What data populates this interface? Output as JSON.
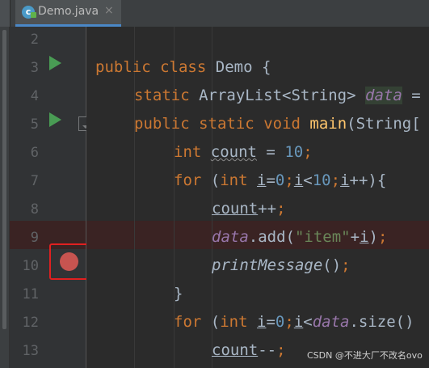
{
  "tab": {
    "title": "Demo.java",
    "close": "×",
    "icon_letter": "c"
  },
  "line_numbers": [
    "2",
    "3",
    "4",
    "5",
    "6",
    "7",
    "8",
    "9",
    "10",
    "11",
    "12",
    "13"
  ],
  "code": {
    "l3": {
      "kw1": "public",
      "kw2": "class",
      "name": "Demo",
      "rest": " {"
    },
    "l4": {
      "kw": "static",
      "type": "ArrayList<String>",
      "field": "data",
      "rest": " ="
    },
    "l5": {
      "kw1": "public",
      "kw2": "static",
      "kw3": "void",
      "method": "main",
      "rest": "(String["
    },
    "l6": {
      "kw": "int",
      "var": "count",
      "op": " = ",
      "num": "10",
      "semi": ";"
    },
    "l7": {
      "kw": "for",
      "p1": " (",
      "kw2": "int",
      "sp": " ",
      "i1": "i",
      "eq": "=",
      "n0": "0",
      "s1": ";",
      "i2": "i",
      "lt": "<",
      "n10": "10",
      "s2": ";",
      "i3": "i",
      "rest": "++){"
    },
    "l8": {
      "var": "count",
      "rest": "++",
      "semi": ";"
    },
    "l9": {
      "field": "data",
      "call": ".add(",
      "str": "\"item\"",
      "plus": "+",
      "i": "i",
      "end": ")",
      "semi": ";"
    },
    "l10": {
      "method": "printMessage",
      "rest": "()",
      "semi": ";"
    },
    "l11": {
      "brace": "}"
    },
    "l12": {
      "kw": "for",
      "p1": " (",
      "kw2": "int",
      "sp": " ",
      "i1": "i",
      "eq": "=",
      "n0": "0",
      "s1": ";",
      "i2": "i",
      "lt": "<",
      "field": "data",
      "rest": ".size()"
    },
    "l13": {
      "var": "count",
      "rest": "--",
      "semi": ";"
    }
  },
  "watermark": "CSDN @不进大厂不改名ovo",
  "colors": {
    "keyword": "#cc7832",
    "field": "#9876aa",
    "method": "#ffc66d",
    "string": "#6a8759",
    "number": "#6897bb",
    "breakpoint": "#c75450",
    "highlight_box": "#e02020",
    "run": "#499c54"
  },
  "icons": {
    "run": "run-gutter-icon",
    "breakpoint": "breakpoint-icon",
    "fold": "fold-icon",
    "tab": "java-class-icon"
  }
}
